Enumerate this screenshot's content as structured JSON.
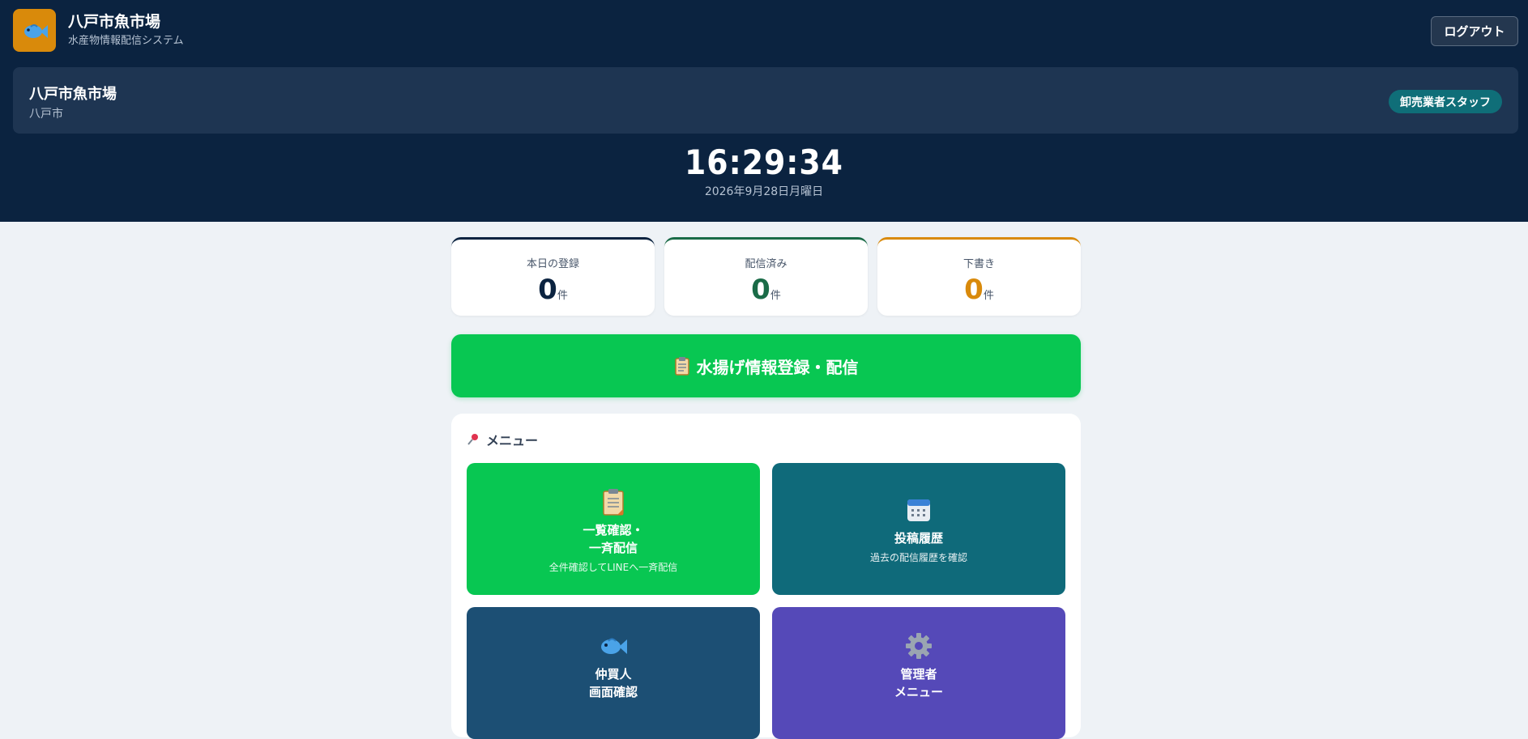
{
  "app": {
    "title": "八戸市魚市場",
    "subtitle": "水産物情報配信システム",
    "logout_label": "ログアウト"
  },
  "market": {
    "name": "八戸市魚市場",
    "city": "八戸市",
    "role": "卸売業者スタッフ"
  },
  "clock": {
    "time": "16:29:34",
    "date": "2026年9月28日月曜日"
  },
  "stats": [
    {
      "label": "本日の登録",
      "value": "0",
      "unit": "件",
      "color": "#0b2340"
    },
    {
      "label": "配信済み",
      "value": "0",
      "unit": "件",
      "color": "#1a6b47"
    },
    {
      "label": "下書き",
      "value": "0",
      "unit": "件",
      "color": "#d98a0b"
    }
  ],
  "register_button": {
    "label": "水揚げ情報登録・配信",
    "icon": "clipboard-icon"
  },
  "menu": {
    "title": "メニュー",
    "title_icon": "pushpin-icon",
    "tiles": [
      {
        "title_line1": "一覧確認・",
        "title_line2": "一斉配信",
        "sub": "全件確認してLINEへ一斉配信",
        "icon": "clipboard-icon",
        "color": "#08c752"
      },
      {
        "title_line1": "投稿履歴",
        "title_line2": "",
        "sub": "過去の配信履歴を確認",
        "icon": "calendar-icon",
        "color": "#0f6a7a"
      },
      {
        "title_line1": "仲買人",
        "title_line2": "画面確認",
        "sub": "",
        "icon": "fish-icon",
        "color": "#1c4f74"
      },
      {
        "title_line1": "管理者",
        "title_line2": "メニュー",
        "sub": "",
        "icon": "gear-icon",
        "color": "#5549b8"
      }
    ]
  }
}
